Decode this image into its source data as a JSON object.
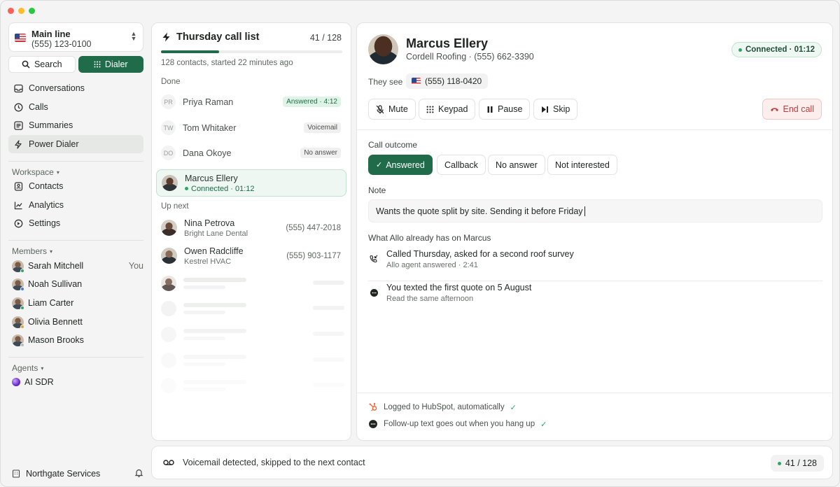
{
  "sidebar": {
    "line": {
      "title": "Main line",
      "number": "(555) 123-0100"
    },
    "seg": {
      "search": "Search",
      "dialer": "Dialer"
    },
    "nav": [
      {
        "label": "Conversations",
        "icon": "inbox-icon"
      },
      {
        "label": "Calls",
        "icon": "clock-icon"
      },
      {
        "label": "Summaries",
        "icon": "list-icon"
      },
      {
        "label": "Power Dialer",
        "icon": "bolt-icon",
        "active": true
      }
    ],
    "workspace": {
      "title": "Workspace",
      "items": [
        {
          "label": "Contacts",
          "icon": "contacts-icon"
        },
        {
          "label": "Analytics",
          "icon": "chart-icon"
        },
        {
          "label": "Settings",
          "icon": "settings-icon"
        }
      ]
    },
    "members": {
      "title": "Members",
      "items": [
        {
          "name": "Sarah Mitchell",
          "tag": "You",
          "status": "#2ea66a"
        },
        {
          "name": "Noah Sullivan",
          "status": "#4a7bd8"
        },
        {
          "name": "Liam Carter",
          "status": "#2ea66a"
        },
        {
          "name": "Olivia Bennett",
          "status": "#e0a63a"
        },
        {
          "name": "Mason Brooks",
          "status": "#b8bcb9"
        }
      ]
    },
    "agents": {
      "title": "Agents",
      "items": [
        {
          "name": "AI SDR"
        }
      ]
    },
    "org": "Northgate Services"
  },
  "list": {
    "title": "Thursday call list",
    "count": "41 / 128",
    "progress": 0.32,
    "subtitle": "128 contacts, started 22 minutes ago",
    "done_label": "Done",
    "done": [
      {
        "initials": "PR",
        "name": "Priya Raman",
        "badge": "Answered · 4:12",
        "kind": "ans"
      },
      {
        "initials": "TW",
        "name": "Tom Whitaker",
        "badge": "Voicemail",
        "kind": "plain"
      },
      {
        "initials": "DO",
        "name": "Dana Okoye",
        "badge": "No answer",
        "kind": "plain"
      }
    ],
    "current": {
      "name": "Marcus Ellery",
      "status": "Connected · 01:12"
    },
    "upnext_label": "Up next",
    "upnext": [
      {
        "name": "Nina Petrova",
        "company": "Bright Lane Dental",
        "phone": "(555) 447-2018"
      },
      {
        "name": "Owen Radcliffe",
        "company": "Kestrel HVAC",
        "phone": "(555) 903-1177"
      }
    ]
  },
  "call": {
    "name": "Marcus Ellery",
    "company_line": "Cordell Roofing · (555) 662-3390",
    "status": "Connected · 01:12",
    "they_see_label": "They see",
    "they_see_number": "(555) 118-0420",
    "controls": {
      "mute": "Mute",
      "keypad": "Keypad",
      "pause": "Pause",
      "skip": "Skip",
      "end": "End call"
    },
    "outcome_label": "Call outcome",
    "outcomes": [
      "Answered",
      "Callback",
      "No answer",
      "Not interested"
    ],
    "note_label": "Note",
    "note_value": "Wants the quote split by site. Sending it before Friday",
    "history_label": "What Allo already has on Marcus",
    "history": [
      {
        "title": "Called Thursday, asked for a second roof survey",
        "sub": "Allo agent answered · 2:41"
      },
      {
        "title": "You texted the first quote on 5 August",
        "sub": "Read the same afternoon"
      }
    ],
    "footer": [
      "Logged to HubSpot, automatically",
      "Follow-up text goes out when you hang up"
    ]
  },
  "bottom": {
    "message": "Voicemail detected, skipped to the next contact",
    "count": "41 / 128"
  },
  "colors": {
    "accent": "#1f6b4a",
    "danger": "#c23b3b",
    "online": "#2ea66a"
  }
}
